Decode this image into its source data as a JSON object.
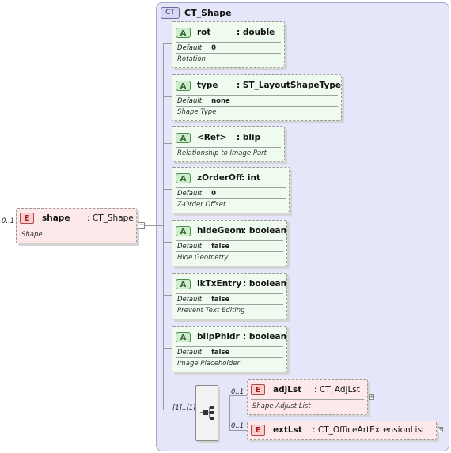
{
  "root_element": {
    "occurrence": "0..1",
    "name": "shape",
    "type": ": CT_Shape",
    "doc": "Shape",
    "badge": "E"
  },
  "complex_type": {
    "badge": "CT",
    "name": "CT_Shape"
  },
  "attributes": [
    {
      "badge": "A",
      "name": "rot",
      "type": ": double",
      "default_label": "Default",
      "default_value": "0",
      "doc": "Rotation"
    },
    {
      "badge": "A",
      "name": "type",
      "type": ": ST_LayoutShapeType",
      "default_label": "Default",
      "default_value": "none",
      "doc": "Shape Type"
    },
    {
      "badge": "A",
      "name": "<Ref>",
      "type": ": blip",
      "doc": "Relationship to Image Part"
    },
    {
      "badge": "A",
      "name": "zOrderOff",
      "type": ": int",
      "default_label": "Default",
      "default_value": "0",
      "doc": "Z-Order Offset"
    },
    {
      "badge": "A",
      "name": "hideGeom",
      "type": ": boolean",
      "default_label": "Default",
      "default_value": "false",
      "doc": "Hide Geometry"
    },
    {
      "badge": "A",
      "name": "lkTxEntry",
      "type": ": boolean",
      "default_label": "Default",
      "default_value": "false",
      "doc": "Prevent Text Editing"
    },
    {
      "badge": "A",
      "name": "blipPhldr",
      "type": ": boolean",
      "default_label": "Default",
      "default_value": "false",
      "doc": "Image Placeholder"
    }
  ],
  "sequence": {
    "occurrence": "[1]..[1]"
  },
  "child_elements": [
    {
      "badge": "E",
      "occurrence": "0..1",
      "name": "adjLst",
      "type": ": CT_AdjLst",
      "doc": "Shape Adjust List"
    },
    {
      "badge": "E",
      "occurrence": "0..1",
      "name": "extLst",
      "type": ": CT_OfficeArtExtensionList"
    }
  ],
  "expander_collapse": "−",
  "expander_expand": "+"
}
